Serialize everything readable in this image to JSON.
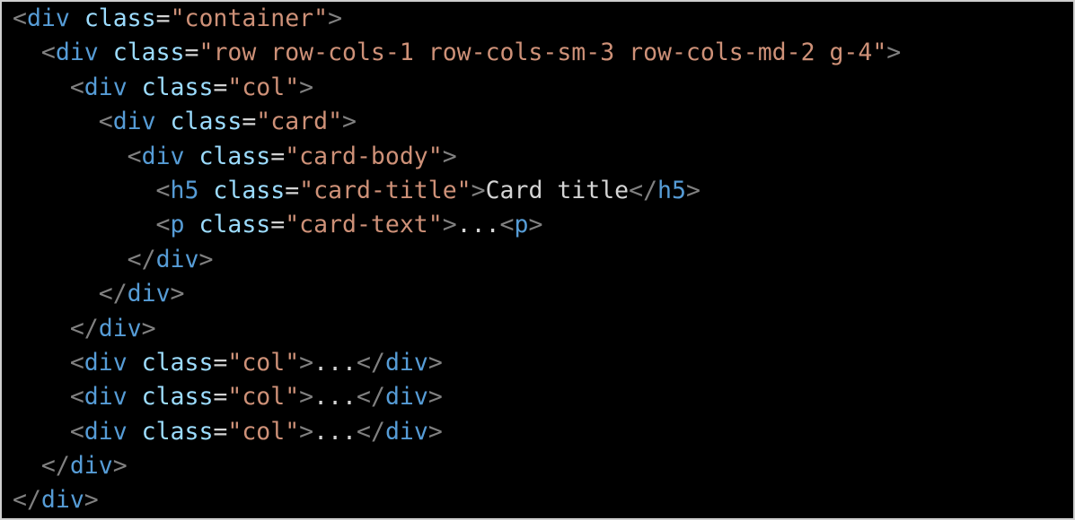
{
  "colors": {
    "background": "#000000",
    "punctuation": "#808080",
    "tag": "#569cd6",
    "attribute": "#9cdcfe",
    "equals": "#d4d4d4",
    "string": "#ce9178",
    "text": "#d4d4d4"
  },
  "code": {
    "language": "html",
    "lines": [
      [
        {
          "t": "punct",
          "v": "<"
        },
        {
          "t": "tag",
          "v": "div"
        },
        {
          "t": "text",
          "v": " "
        },
        {
          "t": "attr",
          "v": "class"
        },
        {
          "t": "eq",
          "v": "="
        },
        {
          "t": "str",
          "v": "\"container\""
        },
        {
          "t": "punct",
          "v": ">"
        }
      ],
      [
        {
          "t": "text",
          "v": "  "
        },
        {
          "t": "punct",
          "v": "<"
        },
        {
          "t": "tag",
          "v": "div"
        },
        {
          "t": "text",
          "v": " "
        },
        {
          "t": "attr",
          "v": "class"
        },
        {
          "t": "eq",
          "v": "="
        },
        {
          "t": "str",
          "v": "\"row row-cols-1 row-cols-sm-3 row-cols-md-2 g-4\""
        },
        {
          "t": "punct",
          "v": ">"
        }
      ],
      [
        {
          "t": "text",
          "v": "    "
        },
        {
          "t": "punct",
          "v": "<"
        },
        {
          "t": "tag",
          "v": "div"
        },
        {
          "t": "text",
          "v": " "
        },
        {
          "t": "attr",
          "v": "class"
        },
        {
          "t": "eq",
          "v": "="
        },
        {
          "t": "str",
          "v": "\"col\""
        },
        {
          "t": "punct",
          "v": ">"
        }
      ],
      [
        {
          "t": "text",
          "v": "      "
        },
        {
          "t": "punct",
          "v": "<"
        },
        {
          "t": "tag",
          "v": "div"
        },
        {
          "t": "text",
          "v": " "
        },
        {
          "t": "attr",
          "v": "class"
        },
        {
          "t": "eq",
          "v": "="
        },
        {
          "t": "str",
          "v": "\"card\""
        },
        {
          "t": "punct",
          "v": ">"
        }
      ],
      [
        {
          "t": "text",
          "v": "        "
        },
        {
          "t": "punct",
          "v": "<"
        },
        {
          "t": "tag",
          "v": "div"
        },
        {
          "t": "text",
          "v": " "
        },
        {
          "t": "attr",
          "v": "class"
        },
        {
          "t": "eq",
          "v": "="
        },
        {
          "t": "str",
          "v": "\"card-body\""
        },
        {
          "t": "punct",
          "v": ">"
        }
      ],
      [
        {
          "t": "text",
          "v": "          "
        },
        {
          "t": "punct",
          "v": "<"
        },
        {
          "t": "tag",
          "v": "h5"
        },
        {
          "t": "text",
          "v": " "
        },
        {
          "t": "attr",
          "v": "class"
        },
        {
          "t": "eq",
          "v": "="
        },
        {
          "t": "str",
          "v": "\"card-title\""
        },
        {
          "t": "punct",
          "v": ">"
        },
        {
          "t": "text",
          "v": "Card title"
        },
        {
          "t": "punct",
          "v": "</"
        },
        {
          "t": "tag",
          "v": "h5"
        },
        {
          "t": "punct",
          "v": ">"
        }
      ],
      [
        {
          "t": "text",
          "v": "          "
        },
        {
          "t": "punct",
          "v": "<"
        },
        {
          "t": "tag",
          "v": "p"
        },
        {
          "t": "text",
          "v": " "
        },
        {
          "t": "attr",
          "v": "class"
        },
        {
          "t": "eq",
          "v": "="
        },
        {
          "t": "str",
          "v": "\"card-text\""
        },
        {
          "t": "punct",
          "v": ">"
        },
        {
          "t": "text",
          "v": "..."
        },
        {
          "t": "punct",
          "v": "<"
        },
        {
          "t": "tag",
          "v": "p"
        },
        {
          "t": "punct",
          "v": ">"
        }
      ],
      [
        {
          "t": "text",
          "v": "        "
        },
        {
          "t": "punct",
          "v": "</"
        },
        {
          "t": "tag",
          "v": "div"
        },
        {
          "t": "punct",
          "v": ">"
        }
      ],
      [
        {
          "t": "text",
          "v": "      "
        },
        {
          "t": "punct",
          "v": "</"
        },
        {
          "t": "tag",
          "v": "div"
        },
        {
          "t": "punct",
          "v": ">"
        }
      ],
      [
        {
          "t": "text",
          "v": "    "
        },
        {
          "t": "punct",
          "v": "</"
        },
        {
          "t": "tag",
          "v": "div"
        },
        {
          "t": "punct",
          "v": ">"
        }
      ],
      [
        {
          "t": "text",
          "v": "    "
        },
        {
          "t": "punct",
          "v": "<"
        },
        {
          "t": "tag",
          "v": "div"
        },
        {
          "t": "text",
          "v": " "
        },
        {
          "t": "attr",
          "v": "class"
        },
        {
          "t": "eq",
          "v": "="
        },
        {
          "t": "str",
          "v": "\"col\""
        },
        {
          "t": "punct",
          "v": ">"
        },
        {
          "t": "text",
          "v": "..."
        },
        {
          "t": "punct",
          "v": "</"
        },
        {
          "t": "tag",
          "v": "div"
        },
        {
          "t": "punct",
          "v": ">"
        }
      ],
      [
        {
          "t": "text",
          "v": "    "
        },
        {
          "t": "punct",
          "v": "<"
        },
        {
          "t": "tag",
          "v": "div"
        },
        {
          "t": "text",
          "v": " "
        },
        {
          "t": "attr",
          "v": "class"
        },
        {
          "t": "eq",
          "v": "="
        },
        {
          "t": "str",
          "v": "\"col\""
        },
        {
          "t": "punct",
          "v": ">"
        },
        {
          "t": "text",
          "v": "..."
        },
        {
          "t": "punct",
          "v": "</"
        },
        {
          "t": "tag",
          "v": "div"
        },
        {
          "t": "punct",
          "v": ">"
        }
      ],
      [
        {
          "t": "text",
          "v": "    "
        },
        {
          "t": "punct",
          "v": "<"
        },
        {
          "t": "tag",
          "v": "div"
        },
        {
          "t": "text",
          "v": " "
        },
        {
          "t": "attr",
          "v": "class"
        },
        {
          "t": "eq",
          "v": "="
        },
        {
          "t": "str",
          "v": "\"col\""
        },
        {
          "t": "punct",
          "v": ">"
        },
        {
          "t": "text",
          "v": "..."
        },
        {
          "t": "punct",
          "v": "</"
        },
        {
          "t": "tag",
          "v": "div"
        },
        {
          "t": "punct",
          "v": ">"
        }
      ],
      [
        {
          "t": "text",
          "v": "  "
        },
        {
          "t": "punct",
          "v": "</"
        },
        {
          "t": "tag",
          "v": "div"
        },
        {
          "t": "punct",
          "v": ">"
        }
      ],
      [
        {
          "t": "punct",
          "v": "</"
        },
        {
          "t": "tag",
          "v": "div"
        },
        {
          "t": "punct",
          "v": ">"
        }
      ]
    ]
  }
}
